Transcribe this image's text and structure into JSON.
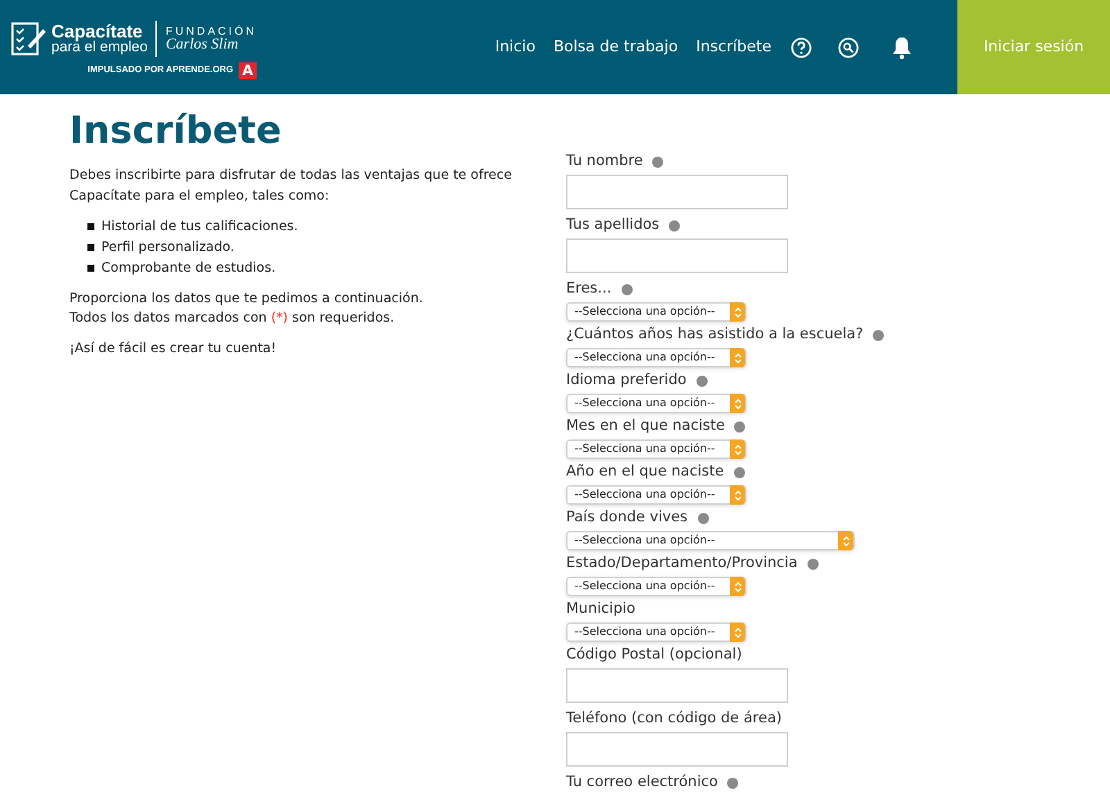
{
  "header": {
    "logo": {
      "title": "Capacítate",
      "subtitle": "para el empleo",
      "foundation": "FUNDACIÓN",
      "foundation_name": "Carlos Slim",
      "powered_by": "IMPULSADO POR APRENDE.ORG",
      "badge": "A"
    },
    "nav": [
      {
        "label": "Inicio",
        "selected": false
      },
      {
        "label": "Bolsa de trabajo",
        "selected": false
      },
      {
        "label": "Inscríbete",
        "selected": false
      }
    ],
    "login": "Iniciar sesión"
  },
  "title": "Inscríbete",
  "intro": "Debes inscribirte para disfrutar de todas las ventajas que te ofrece Capacítate para el empleo, tales como:",
  "benefits": [
    "Historial de tus calificaciones.",
    "Perfil personalizado.",
    "Comprobante de estudios."
  ],
  "instructions": [
    "Proporciona los datos que te pedimos a continuación.",
    "Todos los datos marcados con **(*)** son requeridos."
  ],
  "closing": "¡Así de fácil es crear tu cuenta!",
  "fields": [
    {
      "kind": "text",
      "label": "Tu nombre",
      "required": true
    },
    {
      "kind": "text",
      "label": "Tus apellidos",
      "required": true
    },
    {
      "kind": "select",
      "label": "Eres...",
      "required": true,
      "value": "--Selecciona una opción--",
      "wide": false
    },
    {
      "kind": "select",
      "label": "¿Cuántos años has asistido a la escuela?",
      "required": true,
      "value": "--Selecciona una opción--",
      "wide": false
    },
    {
      "kind": "select",
      "label": "Idioma preferido",
      "required": true,
      "value": "--Selecciona una opción--",
      "wide": false
    },
    {
      "kind": "select",
      "label": "Mes en el que naciste",
      "required": true,
      "value": "--Selecciona una opción--",
      "wide": false
    },
    {
      "kind": "select",
      "label": "Año en el que naciste",
      "required": true,
      "value": "--Selecciona una opción--",
      "wide": false
    },
    {
      "kind": "select",
      "label": "País donde vives",
      "required": true,
      "value": "--Selecciona una opción--",
      "wide": true
    },
    {
      "kind": "select",
      "label": "Estado/Departamento/Provincia",
      "required": true,
      "value": "--Selecciona una opción--",
      "wide": false
    },
    {
      "kind": "select",
      "label": "Municipio",
      "required": false,
      "value": "--Selecciona una opción--",
      "wide": false
    },
    {
      "kind": "text",
      "label": "Código Postal (opcional)",
      "required": false
    },
    {
      "kind": "text",
      "label": "Teléfono (con código de área)",
      "required": false
    },
    {
      "kind": "label",
      "label": "Tu correo electrónico",
      "required": true
    }
  ]
}
